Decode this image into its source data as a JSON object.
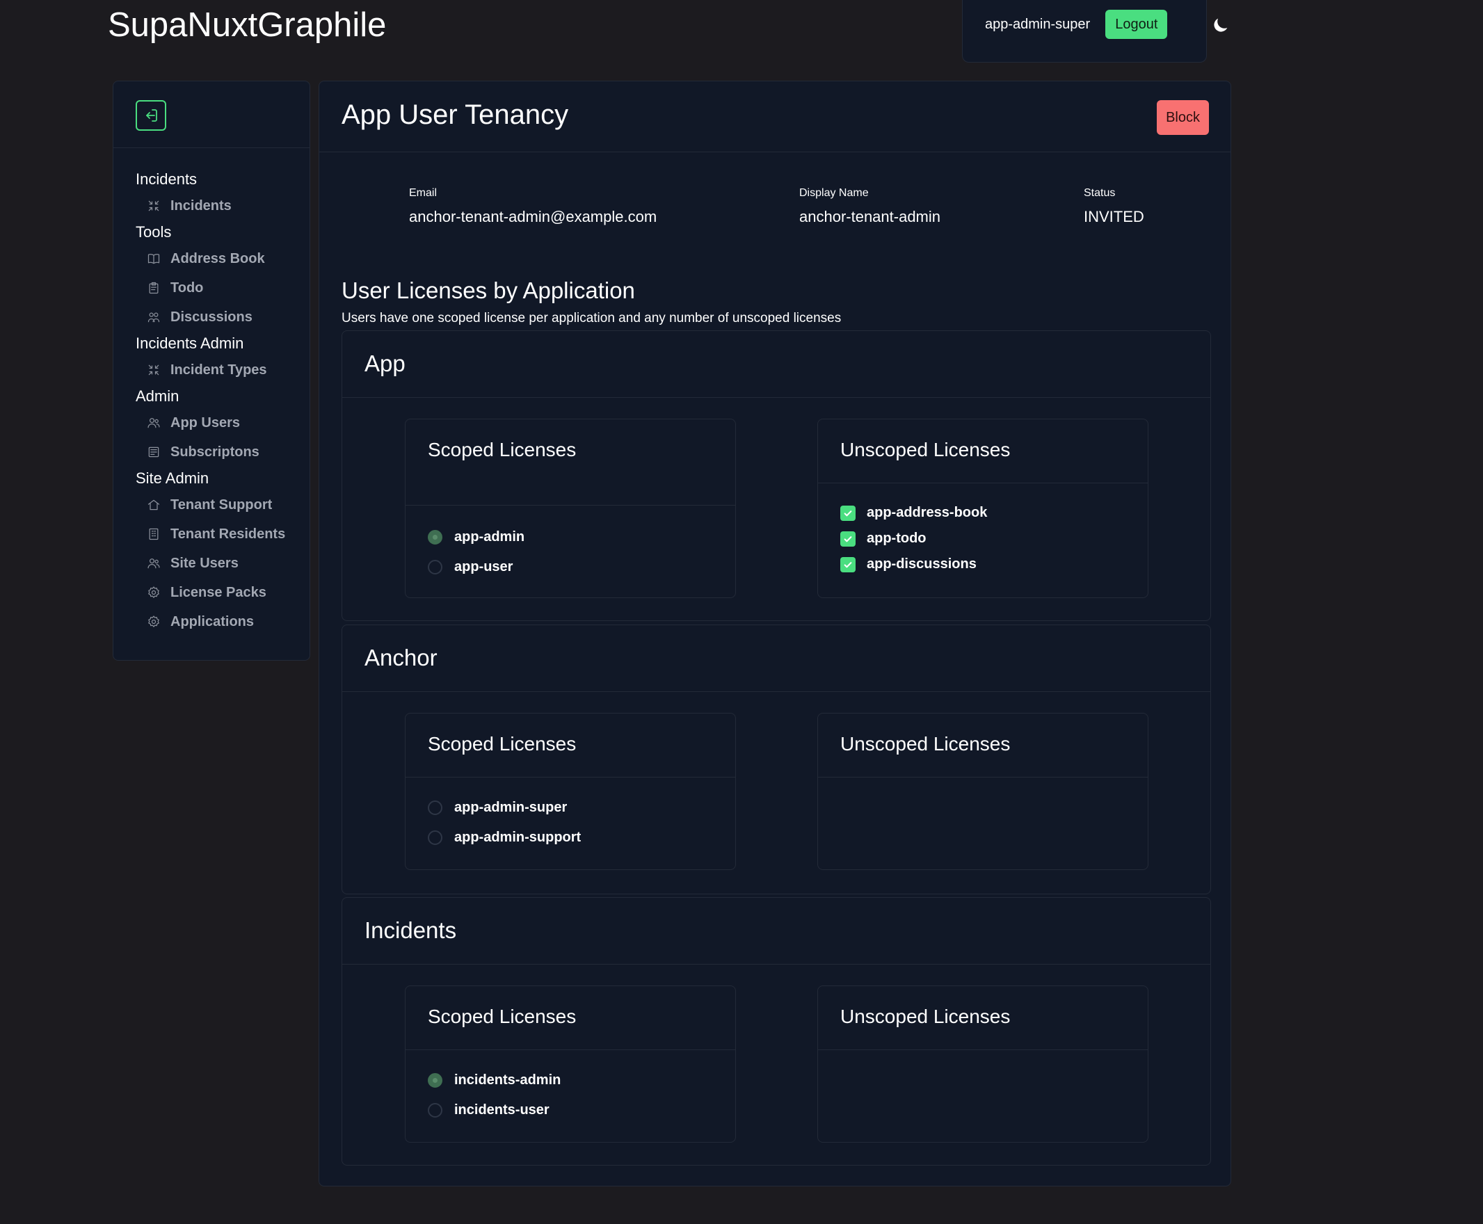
{
  "app": {
    "title": "SupaNuxtGraphile"
  },
  "header": {
    "username": "app-admin-super",
    "logout_label": "Logout"
  },
  "sidebar": {
    "groups": [
      {
        "label": "Incidents",
        "items": [
          {
            "label": "Incidents",
            "icon": "compress-icon"
          }
        ]
      },
      {
        "label": "Tools",
        "items": [
          {
            "label": "Address Book",
            "icon": "book-icon"
          },
          {
            "label": "Todo",
            "icon": "clipboard-icon"
          },
          {
            "label": "Discussions",
            "icon": "chat-icon"
          }
        ]
      },
      {
        "label": "Incidents Admin",
        "items": [
          {
            "label": "Incident Types",
            "icon": "compress-icon"
          }
        ]
      },
      {
        "label": "Admin",
        "items": [
          {
            "label": "App Users",
            "icon": "users-icon"
          },
          {
            "label": "Subscriptons",
            "icon": "newspaper-icon"
          }
        ]
      },
      {
        "label": "Site Admin",
        "items": [
          {
            "label": "Tenant Support",
            "icon": "home-icon"
          },
          {
            "label": "Tenant Residents",
            "icon": "building-icon"
          },
          {
            "label": "Site Users",
            "icon": "users-icon"
          },
          {
            "label": "License Packs",
            "icon": "gear-icon"
          },
          {
            "label": "Applications",
            "icon": "gear-icon"
          }
        ]
      }
    ]
  },
  "main": {
    "title": "App User Tenancy",
    "block_label": "Block",
    "email_label": "Email",
    "email": "anchor-tenant-admin@example.com",
    "display_name_label": "Display Name",
    "display_name": "anchor-tenant-admin",
    "status_label": "Status",
    "status": "INVITED",
    "section_title": "User Licenses by Application",
    "section_subtitle": "Users have one scoped license per application and any number of unscoped licenses",
    "scoped_title": "Scoped Licenses",
    "unscoped_title": "Unscoped Licenses",
    "applications": [
      {
        "name": "App",
        "scoped": [
          {
            "label": "app-admin",
            "selected": true
          },
          {
            "label": "app-user",
            "selected": false
          }
        ],
        "unscoped": [
          {
            "label": "app-address-book",
            "checked": true
          },
          {
            "label": "app-todo",
            "checked": true
          },
          {
            "label": "app-discussions",
            "checked": true
          }
        ]
      },
      {
        "name": "Anchor",
        "scoped": [
          {
            "label": "app-admin-super",
            "selected": false
          },
          {
            "label": "app-admin-support",
            "selected": false
          }
        ],
        "unscoped": []
      },
      {
        "name": "Incidents",
        "scoped": [
          {
            "label": "incidents-admin",
            "selected": true
          },
          {
            "label": "incidents-user",
            "selected": false
          }
        ],
        "unscoped": []
      }
    ]
  },
  "colors": {
    "background": "#1c1b1f",
    "panel": "#111827",
    "accent": "#4ade80",
    "danger": "#f87171"
  }
}
